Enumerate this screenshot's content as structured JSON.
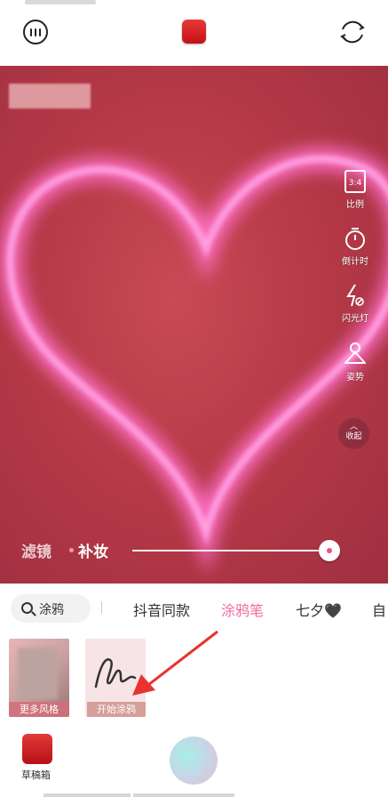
{
  "topbar": {
    "menu_icon": "more-dots-icon",
    "record_icon": "red-square-icon",
    "flip_icon": "camera-flip-icon"
  },
  "side_tools": [
    {
      "label": "比例",
      "icon": "aspect-ratio-icon",
      "badge": "3:4"
    },
    {
      "label": "倒计时",
      "icon": "timer-icon"
    },
    {
      "label": "闪光灯",
      "icon": "flash-off-icon"
    },
    {
      "label": "姿势",
      "icon": "pose-icon"
    }
  ],
  "collapse": {
    "label": "收起"
  },
  "filter_bar": {
    "tab_filter": "滤镜",
    "tab_makeup": "补妆",
    "slider_value": 1.0
  },
  "search": {
    "value": "涂鸦"
  },
  "categories": [
    "抖音同款",
    "涂鸦笔",
    "七夕🖤",
    "自"
  ],
  "active_category": "涂鸦笔",
  "cards": [
    {
      "label": "更多风格"
    },
    {
      "label": "开始涂鸦"
    }
  ],
  "bottom": {
    "drafts_label": "草稿箱"
  },
  "colors": {
    "accent": "#f06aa0",
    "record": "#d9232a"
  }
}
